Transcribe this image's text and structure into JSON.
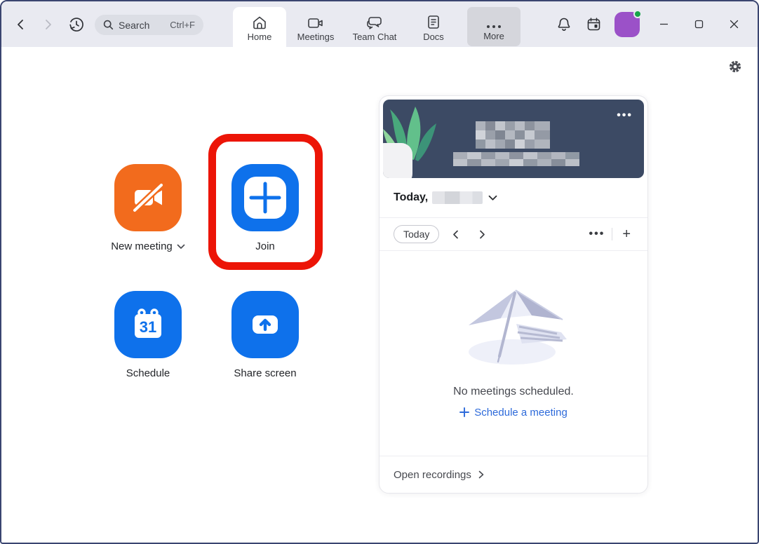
{
  "titlebar": {
    "search": {
      "placeholder": "Search",
      "shortcut": "Ctrl+F"
    },
    "tabs": [
      {
        "label": "Home",
        "active": true
      },
      {
        "label": "Meetings",
        "active": false
      },
      {
        "label": "Team Chat",
        "active": false
      },
      {
        "label": "Docs",
        "active": false
      },
      {
        "label": "More",
        "active": false,
        "hovered": true
      }
    ],
    "icons": [
      "back-arrow-icon",
      "forward-arrow-icon",
      "history-icon",
      "search-icon",
      "bell-icon",
      "calendar-icon",
      "avatar",
      "minimize-icon",
      "maximize-icon",
      "close-icon"
    ],
    "presence_status": "online"
  },
  "actions": [
    {
      "label": "New meeting",
      "icon": "video-off-icon",
      "color": "#f26b1d",
      "has_dropdown": true
    },
    {
      "label": "Join",
      "icon": "plus-icon",
      "color": "#0e71eb",
      "annotated": true
    },
    {
      "label": "Schedule",
      "icon": "calendar-31-icon",
      "color": "#0e71eb",
      "calendar_day": "31"
    },
    {
      "label": "Share screen",
      "icon": "screen-share-arrow-icon",
      "color": "#0e71eb"
    }
  ],
  "annotation": {
    "shape": "red-rounded-rectangle",
    "target": "Join",
    "color": "#ec1507"
  },
  "panel": {
    "banner": {
      "menu_icon": "ellipsis-icon",
      "redacted": [
        "time",
        "date"
      ],
      "background": "#3c4a64",
      "illustration": "plant"
    },
    "today_heading": "Today,",
    "today_date_redacted": true,
    "toolbar": {
      "today_button": "Today",
      "icons": [
        "chevron-left-icon",
        "chevron-right-icon",
        "ellipsis-icon",
        "plus-icon"
      ]
    },
    "empty_state": {
      "illustration": "beach-umbrella",
      "message": "No meetings scheduled.",
      "cta": "Schedule a meeting"
    },
    "footer": {
      "label": "Open recordings",
      "icon": "chevron-right-icon"
    }
  },
  "settings_icon": "gear-icon",
  "colors": {
    "accent_blue": "#0e71eb",
    "action_orange": "#f26b1d",
    "annotation_red": "#ec1507",
    "banner_navy": "#3c4a64",
    "avatar_purple": "#9b51c8",
    "presence_green": "#17a34a",
    "link_blue": "#2d6ada",
    "titlebar_gray": "#e9eaf1"
  }
}
